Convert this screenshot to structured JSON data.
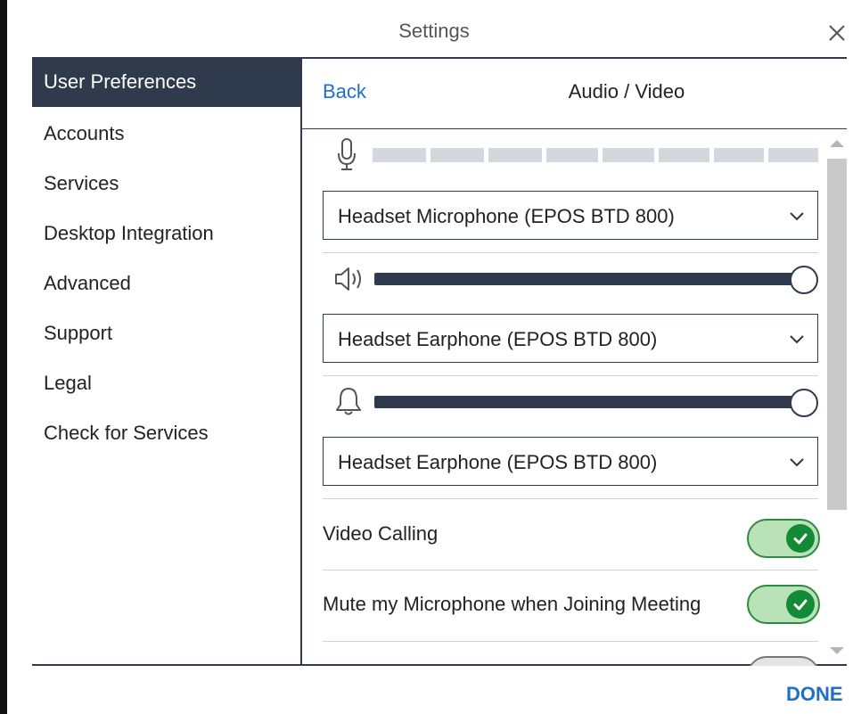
{
  "dialog": {
    "title": "Settings",
    "done_label": "DONE"
  },
  "sidebar": {
    "items": [
      {
        "label": "User Preferences",
        "active": true
      },
      {
        "label": "Accounts"
      },
      {
        "label": "Services"
      },
      {
        "label": "Desktop Integration"
      },
      {
        "label": "Advanced"
      },
      {
        "label": "Support"
      },
      {
        "label": "Legal"
      },
      {
        "label": "Check for Services"
      }
    ]
  },
  "panel": {
    "back_label": "Back",
    "title": "Audio / Video",
    "microphone": {
      "icon": "microphone-icon",
      "level_segments_lit": 0,
      "device": "Headset Microphone (EPOS BTD 800)"
    },
    "speaker": {
      "icon": "speaker-icon",
      "volume_fraction": 1.0,
      "device": "Headset Earphone (EPOS BTD 800)"
    },
    "ringer": {
      "icon": "bell-icon",
      "volume_fraction": 1.0,
      "device": "Headset Earphone (EPOS BTD 800)"
    },
    "toggles": [
      {
        "label": "Video Calling",
        "on": true
      },
      {
        "label": "Mute my Microphone when Joining Meeting",
        "on": true
      }
    ]
  },
  "colors": {
    "nav_active_bg": "#2f3b4d",
    "link": "#1f6fc7",
    "toggle_on": "#138a36",
    "toggle_on_bg": "#b9e2b8"
  }
}
